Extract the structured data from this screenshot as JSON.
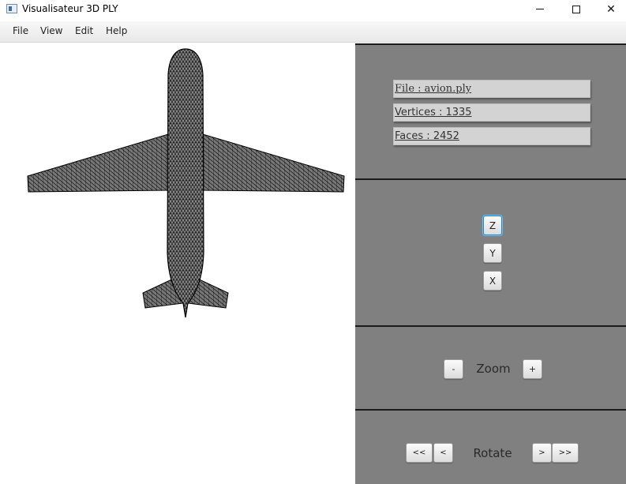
{
  "window": {
    "title": "Visualisateur 3D PLY",
    "icon": "app-window-icon",
    "controls": {
      "minimize": "minimize-icon",
      "maximize": "maximize-icon",
      "close": "✕"
    }
  },
  "menu": {
    "items": [
      {
        "label": "File"
      },
      {
        "label": "View"
      },
      {
        "label": "Edit"
      },
      {
        "label": "Help"
      }
    ]
  },
  "viewport": {
    "model": "airplane-wireframe",
    "background": "#ffffff",
    "mesh_color": "#000000"
  },
  "info": {
    "file": "File : avion.ply",
    "vertices": "Vertices : 1335",
    "faces": "Faces : 2452"
  },
  "axis": {
    "buttons": [
      {
        "label": "Z",
        "focused": true
      },
      {
        "label": "Y",
        "focused": false
      },
      {
        "label": "X",
        "focused": false
      }
    ]
  },
  "zoom": {
    "label": "Zoom",
    "minus": "-",
    "plus": "+"
  },
  "rotate": {
    "label": "Rotate",
    "fast_left": "<<",
    "left": "<",
    "right": ">",
    "fast_right": ">>"
  },
  "colors": {
    "panel_bg": "#808080",
    "divider": "#1a1a1a",
    "info_box_bg": "#d3d3d3",
    "focus_ring": "#1f8ad0"
  }
}
